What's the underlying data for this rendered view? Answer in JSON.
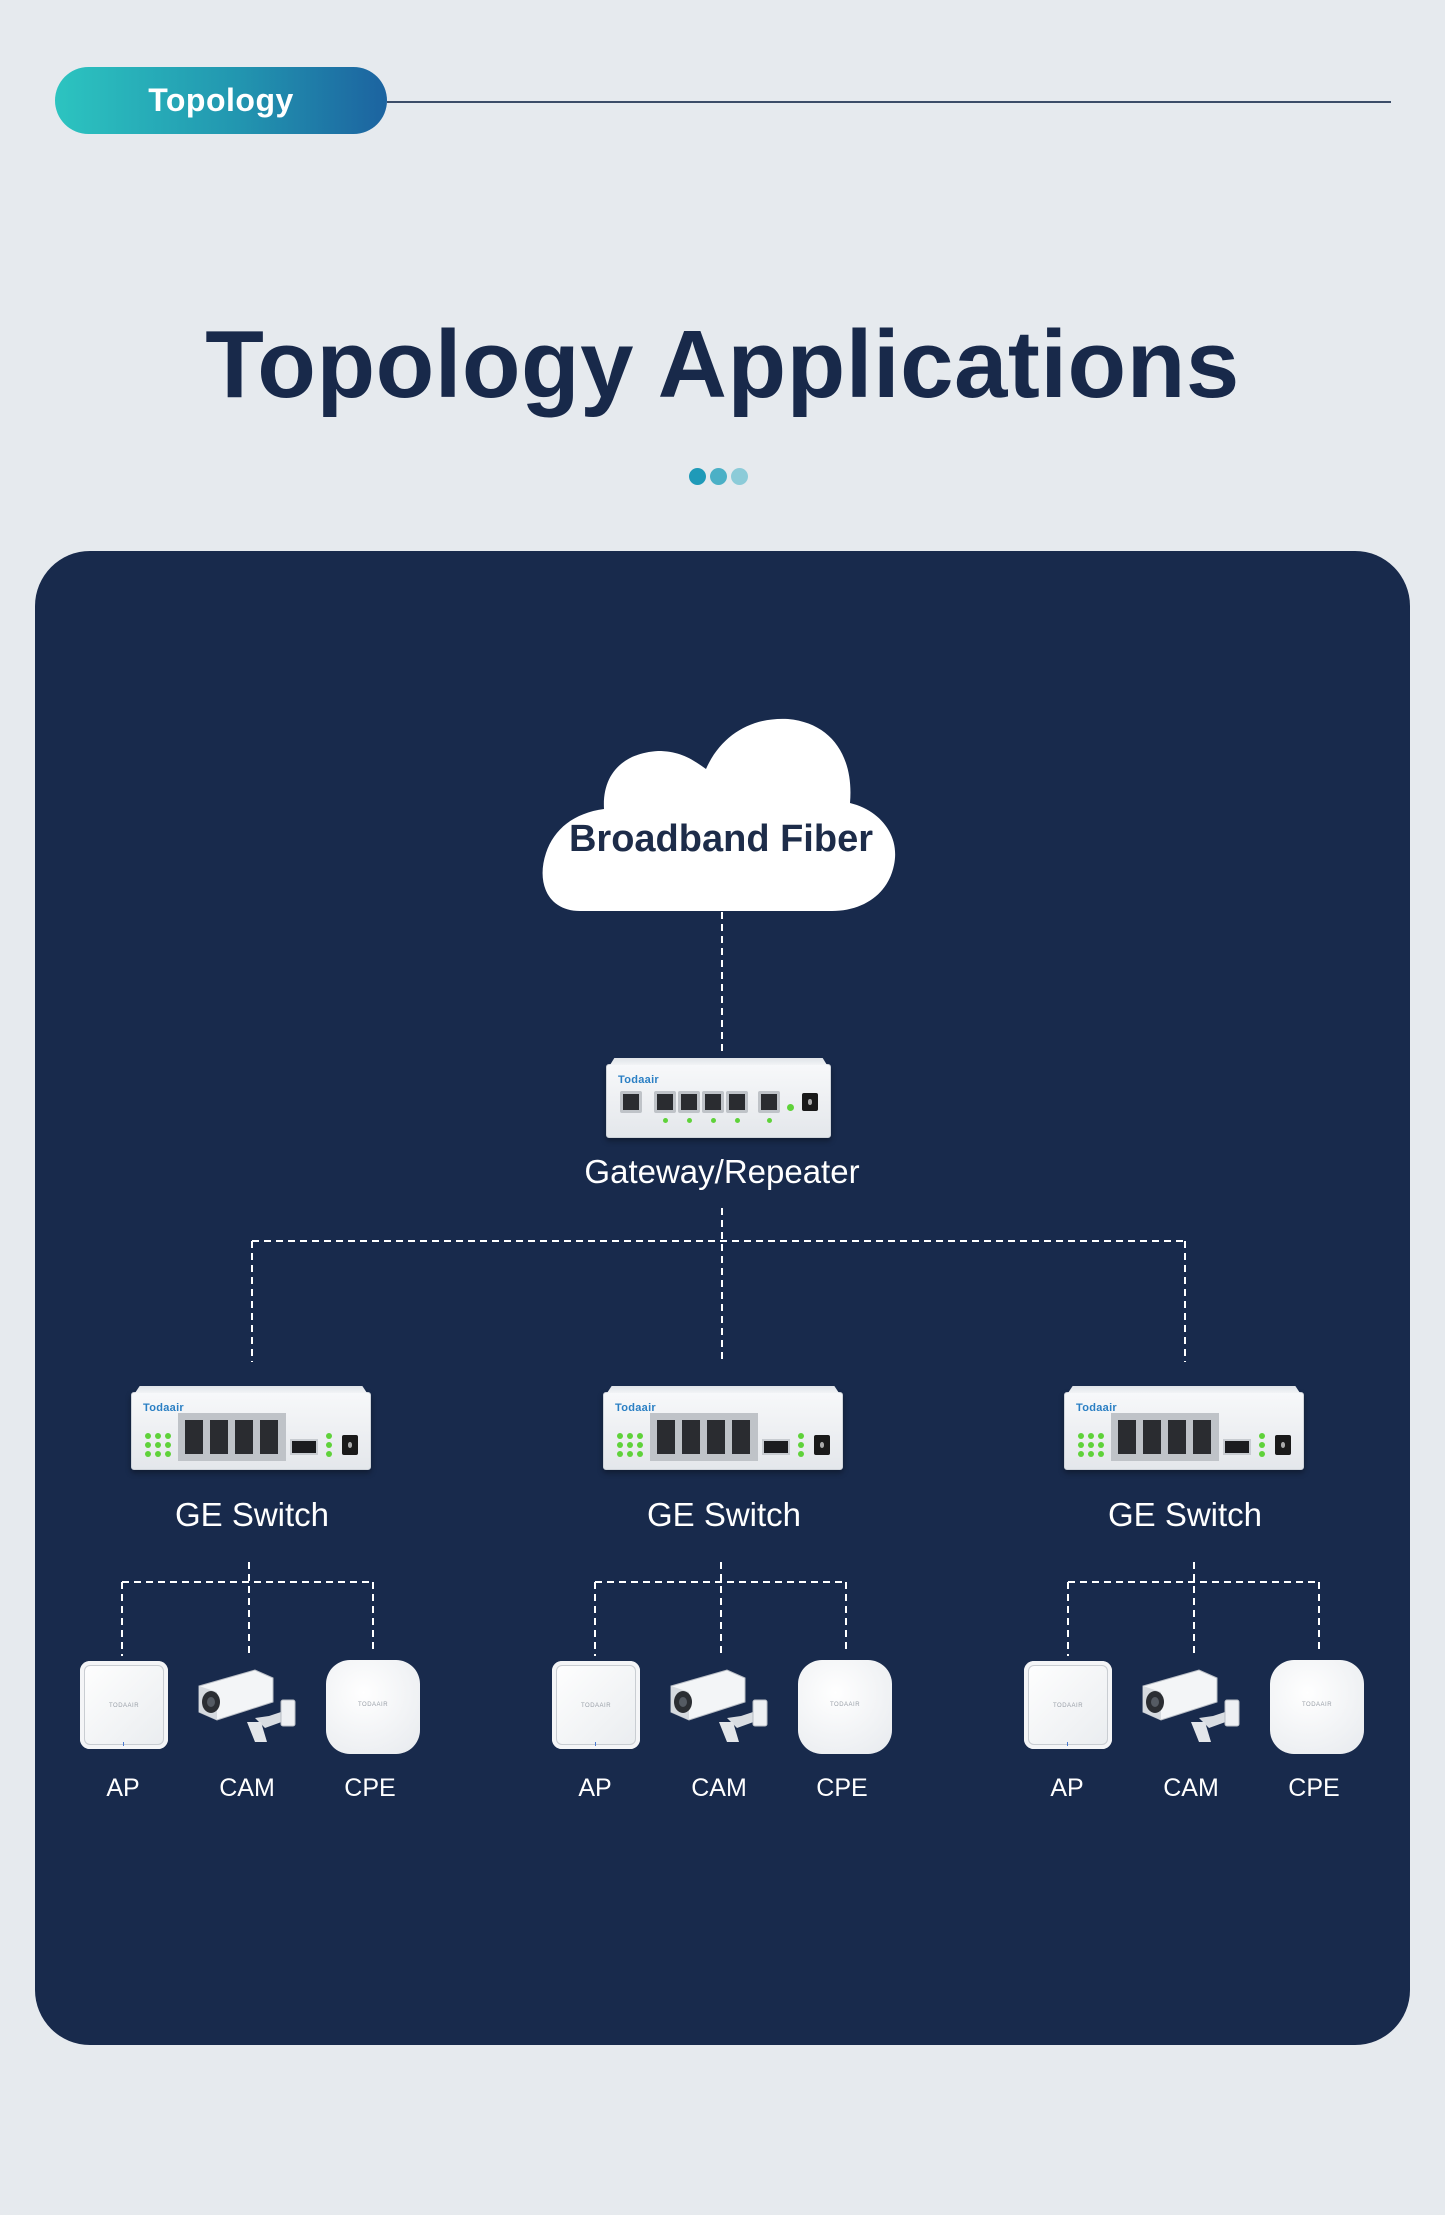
{
  "header": {
    "tag_label": "Topology",
    "title": "Topology Applications"
  },
  "colors": {
    "background": "#e6eaee",
    "panel": "#182a4c",
    "title": "#18294a",
    "tag_gradient_start": "#2cc4c0",
    "tag_gradient_end": "#1c63a0",
    "led_green": "#5fd23a"
  },
  "diagram": {
    "root": {
      "label": "Broadband Fiber",
      "icon": "cloud-icon"
    },
    "gateway": {
      "label": "Gateway/Repeater",
      "brand": "Todaair",
      "icon": "router-icon"
    },
    "switches": [
      {
        "label": "GE Switch",
        "brand": "Todaair",
        "devices": [
          {
            "label": "AP",
            "icon": "access-point-icon"
          },
          {
            "label": "CAM",
            "icon": "camera-icon"
          },
          {
            "label": "CPE",
            "icon": "cpe-icon"
          }
        ]
      },
      {
        "label": "GE Switch",
        "brand": "Todaair",
        "devices": [
          {
            "label": "AP",
            "icon": "access-point-icon"
          },
          {
            "label": "CAM",
            "icon": "camera-icon"
          },
          {
            "label": "CPE",
            "icon": "cpe-icon"
          }
        ]
      },
      {
        "label": "GE Switch",
        "brand": "Todaair",
        "devices": [
          {
            "label": "AP",
            "icon": "access-point-icon"
          },
          {
            "label": "CAM",
            "icon": "camera-icon"
          },
          {
            "label": "CPE",
            "icon": "cpe-icon"
          }
        ]
      }
    ],
    "device_logo_text": "TODAAIR"
  }
}
